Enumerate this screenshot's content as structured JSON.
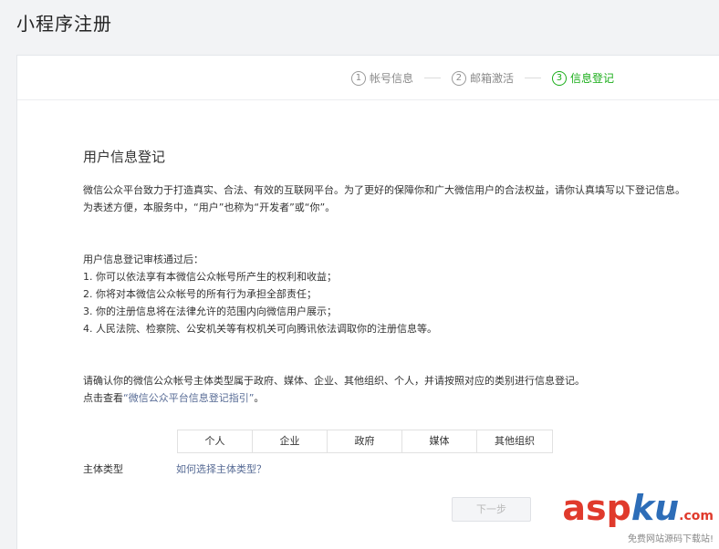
{
  "page_title": "小程序注册",
  "steps": [
    {
      "num": "1",
      "label": "帐号信息",
      "active": false
    },
    {
      "num": "2",
      "label": "邮箱激活",
      "active": false
    },
    {
      "num": "3",
      "label": "信息登记",
      "active": true
    }
  ],
  "content": {
    "title": "用户信息登记",
    "intro_line1": "微信公众平台致力于打造真实、合法、有效的互联网平台。为了更好的保障你和广大微信用户的合法权益，请你认真填写以下登记信息。",
    "intro_line2": "为表述方便，本服务中，“用户”也称为“开发者”或“你”。",
    "after_title": "用户信息登记审核通过后：",
    "after_items": [
      "1. 你可以依法享有本微信公众帐号所产生的权利和收益；",
      "2. 你将对本微信公众帐号的所有行为承担全部责任；",
      "3. 你的注册信息将在法律允许的范围内向微信用户展示；",
      "4. 人民法院、检察院、公安机关等有权机关可向腾讯依法调取你的注册信息等。"
    ],
    "confirm_line": "请确认你的微信公众帐号主体类型属于政府、媒体、企业、其他组织、个人，并请按照对应的类别进行信息登记。",
    "guide_prefix": "点击查看",
    "guide_link": "“微信公众平台信息登记指引”",
    "guide_suffix": "。"
  },
  "subject_type": {
    "label": "主体类型",
    "help_link": "如何选择主体类型？",
    "options": [
      "个人",
      "企业",
      "政府",
      "媒体",
      "其他组织"
    ]
  },
  "next_button": "下一步",
  "watermark": {
    "asp": "asp",
    "ku": "ku",
    "com": ".com",
    "tagline": "免费网站源码下载站!"
  },
  "colors": {
    "accent_green": "#1aad19",
    "link_blue": "#576b95"
  }
}
